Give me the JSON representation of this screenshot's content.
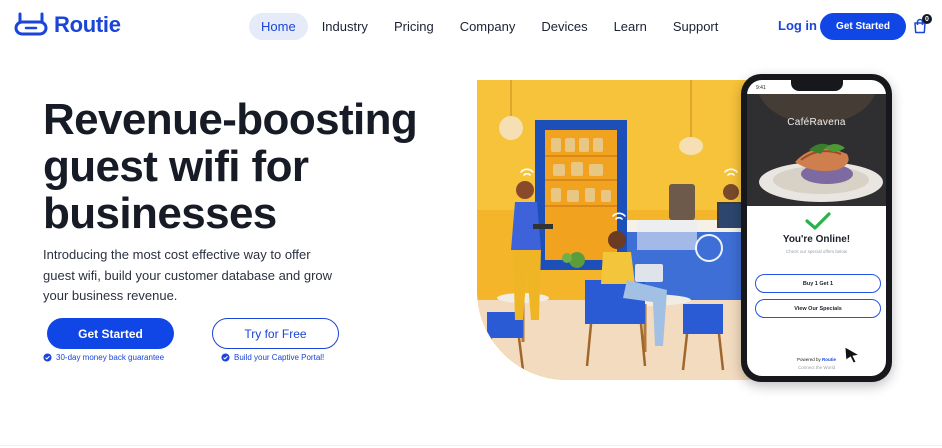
{
  "brand": {
    "name": "Routie",
    "color": "#1a45d8",
    "icon": "router-icon"
  },
  "nav": {
    "items": [
      {
        "label": "Home",
        "active": true
      },
      {
        "label": "Industry",
        "active": false
      },
      {
        "label": "Pricing",
        "active": false
      },
      {
        "label": "Company",
        "active": false
      },
      {
        "label": "Devices",
        "active": false
      },
      {
        "label": "Learn",
        "active": false
      },
      {
        "label": "Support",
        "active": false
      }
    ],
    "login_label": "Log in",
    "cta_label": "Get Started",
    "cart_icon": "shopping-bag-icon",
    "cart_count": "0"
  },
  "hero": {
    "headline": "Revenue-boosting guest wifi for businesses",
    "subtext": "Introducing the most cost effective way to offer guest wifi, build your customer database and grow your business revenue.",
    "primary_cta": "Get Started",
    "secondary_cta": "Try for Free",
    "primary_note": "30-day money back guarantee",
    "secondary_note": "Build your Captive Portal!",
    "accent_color": "#1146e6"
  },
  "phone": {
    "time": "9:41",
    "cafe_name": "CaféRavena",
    "status_title": "You're Online!",
    "status_subtitle": "Check our special offers below",
    "buttons": [
      "Buy 1 Get 1",
      "View Our Specials"
    ],
    "powered_prefix": "Powered by",
    "powered_brand": "Routie",
    "footer": "Connect the World"
  }
}
